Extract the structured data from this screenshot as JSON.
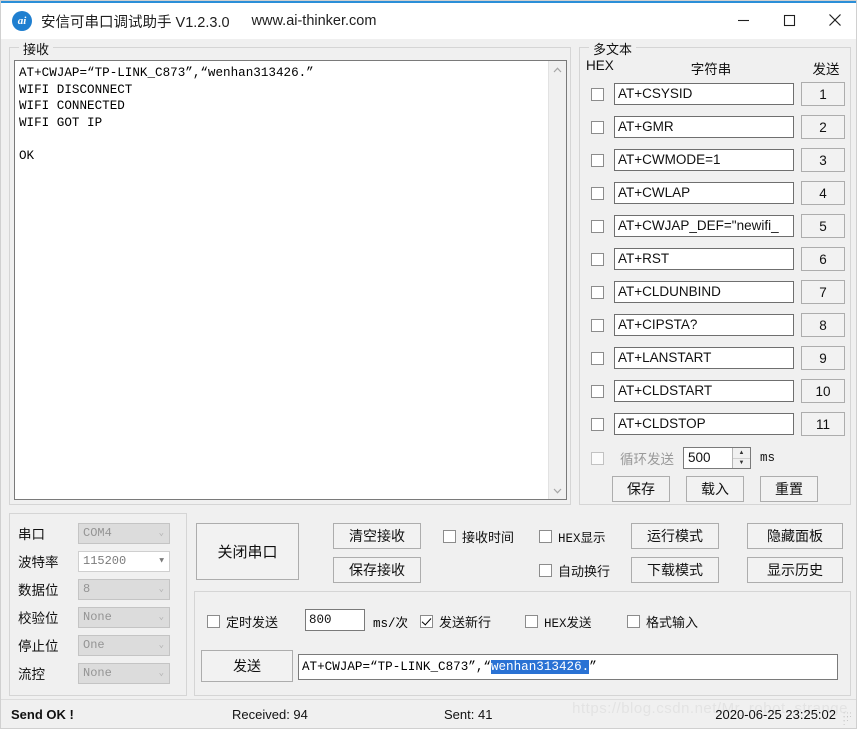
{
  "window": {
    "title": "安信可串口调试助手 V1.2.3.0",
    "url": "www.ai-thinker.com",
    "icon_text": "ai",
    "minimize": "–",
    "maximize": "□",
    "close": "✕"
  },
  "receive": {
    "group_label": "接收",
    "content": "AT+CWJAP=“TP-LINK_C873”,“wenhan313426.”\nWIFI DISCONNECT\nWIFI CONNECTED\nWIFI GOT IP\n\nOK",
    "scroll_up": "⌃",
    "scroll_down": "⌄"
  },
  "multitext": {
    "group_label": "多文本",
    "header_hex": "HEX",
    "header_string": "字符串",
    "header_send": "发送",
    "rows": [
      {
        "checked": false,
        "command": "AT+CSYSID",
        "send": "1"
      },
      {
        "checked": false,
        "command": "AT+GMR",
        "send": "2"
      },
      {
        "checked": false,
        "command": "AT+CWMODE=1",
        "send": "3"
      },
      {
        "checked": false,
        "command": "AT+CWLAP",
        "send": "4"
      },
      {
        "checked": false,
        "command": "AT+CWJAP_DEF=\"newifi_",
        "send": "5"
      },
      {
        "checked": false,
        "command": "AT+RST",
        "send": "6"
      },
      {
        "checked": false,
        "command": "AT+CLDUNBIND",
        "send": "7"
      },
      {
        "checked": false,
        "command": "AT+CIPSTA?",
        "send": "8"
      },
      {
        "checked": false,
        "command": "AT+LANSTART",
        "send": "9"
      },
      {
        "checked": false,
        "command": "AT+CLDSTART",
        "send": "10"
      },
      {
        "checked": false,
        "command": "AT+CLDSTOP",
        "send": "11"
      }
    ],
    "loop_send_label": "循环发送",
    "loop_send_checked": false,
    "loop_interval": "500",
    "loop_unit": "ms",
    "save_label": "保存",
    "load_label": "载入",
    "reset_label": "重置"
  },
  "serial": {
    "rows": [
      {
        "label": "串口",
        "value": "COM4",
        "editable": false
      },
      {
        "label": "波特率",
        "value": "115200",
        "editable": true
      },
      {
        "label": "数据位",
        "value": "8",
        "editable": false
      },
      {
        "label": "校验位",
        "value": "None",
        "editable": false
      },
      {
        "label": "停止位",
        "value": "One",
        "editable": false
      },
      {
        "label": "流控",
        "value": "None",
        "editable": false
      }
    ],
    "close_port_button": "关闭串口"
  },
  "controls": {
    "clear_receive": "清空接收",
    "save_receive": "保存接收",
    "recv_time_label": "接收时间",
    "recv_time_checked": false,
    "hex_display_label": "HEX显示",
    "hex_display_checked": false,
    "auto_wrap_label": "自动换行",
    "auto_wrap_checked": false,
    "run_mode": "运行模式",
    "download_mode": "下载模式",
    "hide_panel": "隐藏面板",
    "show_history": "显示历史"
  },
  "send": {
    "timed_send_label": "定时发送",
    "timed_send_checked": false,
    "period_value": "800",
    "period_unit": "ms/次",
    "newline_label": "发送新行",
    "newline_checked": true,
    "hex_send_label": "HEX发送",
    "hex_send_checked": false,
    "format_input_label": "格式输入",
    "format_input_checked": false,
    "send_button": "发送",
    "input_prefix": "AT+CWJAP=“TP-LINK_C873”,“",
    "input_selected": "wenhan313426.",
    "input_suffix": "”"
  },
  "status": {
    "send_state": "Send OK !",
    "received": "Received: 94",
    "sent": "Sent: 41",
    "timestamp": "2020-06-25 23:25:02",
    "watermark": "https://blog.csdn.net/Mr_robot_strange"
  }
}
